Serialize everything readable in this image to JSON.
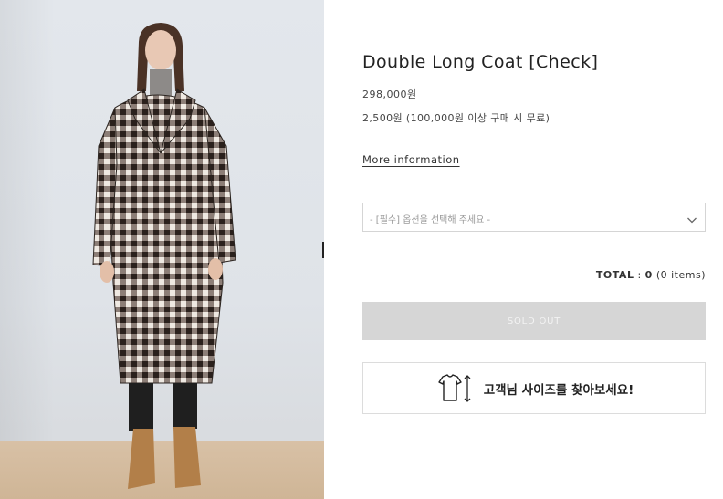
{
  "product": {
    "title": "Double Long Coat [Check]",
    "price": "298,000원",
    "shipping": "2,500원 (100,000원 이상 구매 시 무료)",
    "more_info_link": "More information"
  },
  "option_select": {
    "placeholder": "- [필수] 옵션을 선택해 주세요 -"
  },
  "total": {
    "label": "TOTAL",
    "separator": ":",
    "amount": "0",
    "items": "(0 items)"
  },
  "buttons": {
    "sold_out": "SOLD OUT",
    "size_finder": "고객님 사이즈를 찾아보세요!"
  },
  "icons": {
    "option_dropdown": "chevron-down-icon",
    "size_finder": "tshirt-size-icon"
  },
  "colors": {
    "sold_out_bg": "#d6d6d6",
    "border": "#d5d5d5",
    "text": "#222222"
  }
}
